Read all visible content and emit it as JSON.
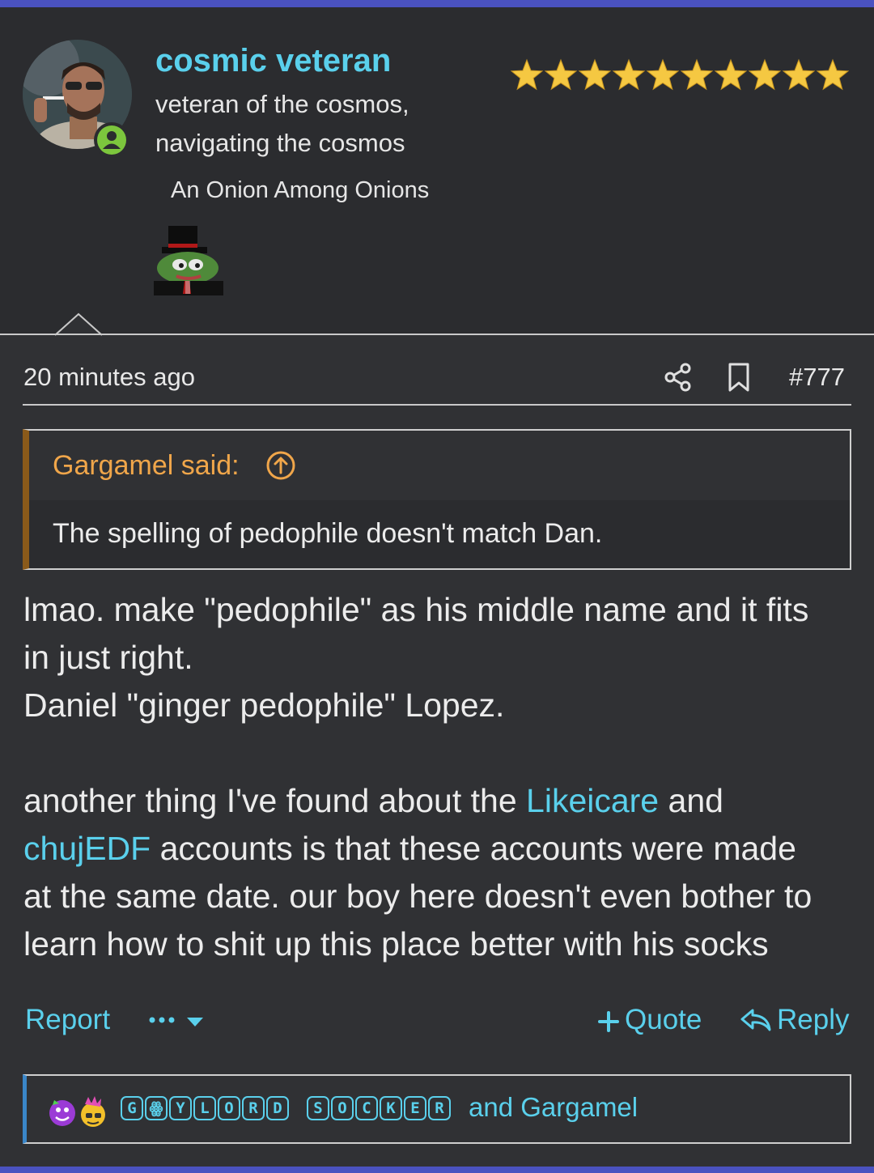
{
  "user": {
    "name": "cosmic veteran",
    "title_line1": "veteran of the cosmos,",
    "title_line2": "navigating the cosmos",
    "banner": "An Onion Among Onions",
    "star_count": 10,
    "online": true
  },
  "post": {
    "time": "20 minutes ago",
    "number": "#777"
  },
  "quote": {
    "author": "Gargamel said:",
    "text": "The spelling of pedophile doesn't match Dan."
  },
  "message": {
    "line1": "lmao. make \"pedophile\" as his middle name and it fits",
    "line2": "in just right.",
    "line3": "Daniel \"ginger pedophile\" Lopez.",
    "p2_part1": "another thing I've found about the ",
    "link1": "Likeicare",
    "p2_part2": " and",
    "link2": "chujEDF",
    "p2_part3": " accounts is that these accounts were made",
    "line6": "at the same date. our boy here doesn't even bother to",
    "line7": "learn how to shit up this place better with his socks"
  },
  "actions": {
    "report": "Report",
    "more": "•••",
    "quote": "Quote",
    "reply": "Reply"
  },
  "reactions": {
    "word1": [
      "G",
      "ꙮ",
      "Y",
      "L",
      "O",
      "R",
      "D"
    ],
    "word2": [
      "S",
      "O",
      "C",
      "K",
      "E",
      "R"
    ],
    "suffix": "and Gargamel"
  },
  "colors": {
    "accent": "#5ad0ec",
    "quote_author": "#f0a64a",
    "top_bar": "#4a52c0",
    "star": "#f5c842",
    "online": "#7cc63d"
  }
}
